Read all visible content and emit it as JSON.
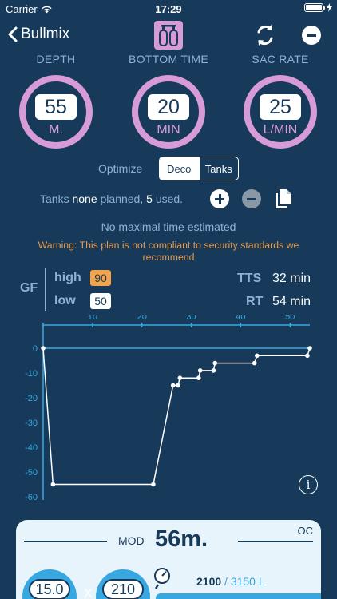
{
  "status_bar": {
    "carrier": "Carrier",
    "time": "17:29"
  },
  "nav": {
    "back_label": "Bullmix"
  },
  "gauges": [
    {
      "title": "DEPTH",
      "value": "55",
      "unit": "M."
    },
    {
      "title": "BOTTOM TIME",
      "value": "20",
      "unit": "MIN"
    },
    {
      "title": "SAC RATE",
      "value": "25",
      "unit": "L/MIN"
    }
  ],
  "optimize": {
    "label": "Optimize",
    "options": [
      "Deco",
      "Tanks"
    ],
    "selected": "Deco"
  },
  "tanks": {
    "prefix": "Tanks",
    "planned_value": "none",
    "planned_text": "planned,",
    "used_value": "5",
    "used_text": "used."
  },
  "no_max_text": "No maximal time estimated",
  "warning_text": "Warning: This plan is not compliant to security standards we recommend",
  "gf": {
    "label": "GF",
    "high_label": "high",
    "high_value": "90",
    "low_label": "low",
    "low_value": "50"
  },
  "stats": {
    "tts_label": "TTS",
    "tts_value": "32 min",
    "rt_label": "RT",
    "rt_value": "54 min"
  },
  "chart_data": {
    "type": "line",
    "x_ticks": [
      0,
      10,
      20,
      30,
      40,
      50
    ],
    "y_ticks": [
      0,
      -10,
      -20,
      -30,
      -40,
      -50,
      -60
    ],
    "xlim": [
      0,
      54
    ],
    "ylim": [
      -60,
      0
    ],
    "x": [
      0,
      2,
      22.3,
      26.3,
      27.3,
      27.7,
      31.5,
      31.8,
      34.5,
      34.8,
      42.8,
      43.3,
      53.5,
      54
    ],
    "y": [
      0,
      -55,
      -55,
      -15,
      -15,
      -12,
      -12,
      -9,
      -9,
      -6,
      -6,
      -3,
      -3,
      0
    ]
  },
  "card": {
    "mode": "OC",
    "mod_label": "MOD",
    "mod_value": "56m.",
    "tank_count": "15.0",
    "multiplier": "X",
    "tank_pressure": "210",
    "gas_used": "2100",
    "gas_total": "/ 3150 L"
  },
  "colors": {
    "background": "#173a5a",
    "accent_pink": "#d79bd8",
    "label_blue": "#8fb3d6",
    "warning": "#e89a4a",
    "gf_high": "#f2a44a",
    "tank_blue": "#36a7e0"
  }
}
